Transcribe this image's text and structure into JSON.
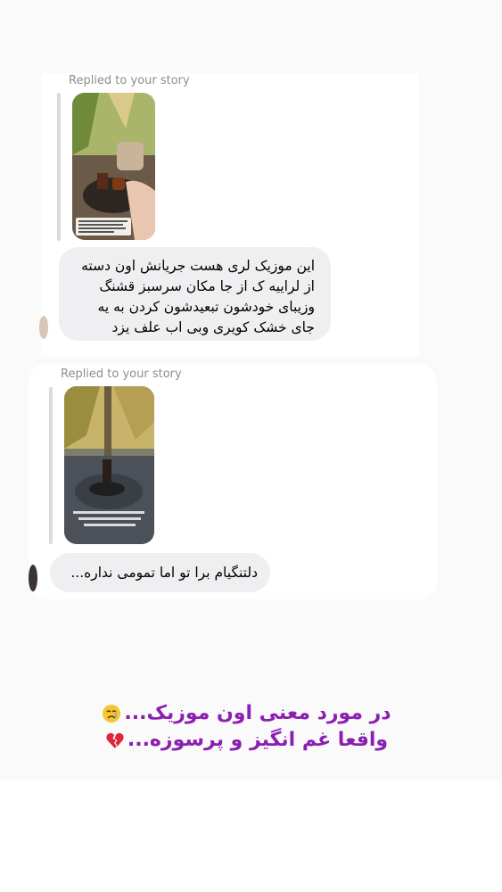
{
  "messages": [
    {
      "replied_label": "Replied to your story",
      "story_icon": "story-photo-cafe-tea",
      "text": "این موزیک لری هست جریانش اون دسته از لراییه ک از جا مکان سرسبز قشنگ وزیبای خودشون تبعیدشون کردن به یه جای خشک کویری وبی اب علف یزد"
    },
    {
      "replied_label": "Replied to your story",
      "story_icon": "story-photo-tea-glass",
      "text": "دلتنگیام برا تو اما تمومی نداره..."
    }
  ],
  "caption": {
    "line1": "در مورد معنی اون موزیک...",
    "line1_emoji": "crying-face-emoji",
    "line2": "واقعا غم انگیز و پرسوزه...",
    "line2_emoji": "broken-heart-emoji",
    "color": "#8b1fb0"
  },
  "colors": {
    "bubble": "#efeff1",
    "label": "#8e8e8e",
    "background": "#fafafa"
  }
}
